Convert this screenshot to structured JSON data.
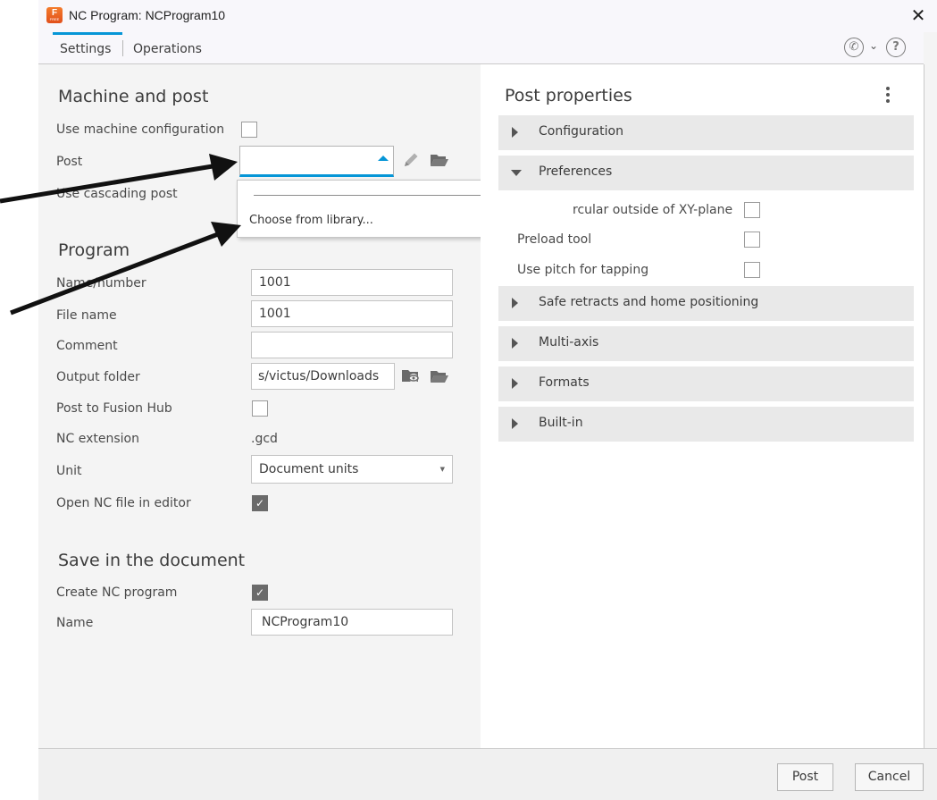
{
  "window": {
    "title": "NC Program: NCProgram10",
    "app_icon_letter": "F",
    "app_icon_sub": "FREE"
  },
  "tabs": {
    "settings": "Settings",
    "operations": "Operations"
  },
  "machine_post": {
    "title": "Machine and post",
    "use_machine_config": "Use machine configuration",
    "post": "Post",
    "use_cascading_post": "Use cascading post",
    "post_value": "",
    "dropdown_item": "Choose from library..."
  },
  "program": {
    "title": "Program",
    "name_number_label": "Name/number",
    "name_number_value": "1001",
    "file_name_label": "File name",
    "file_name_value": "1001",
    "comment_label": "Comment",
    "comment_value": "",
    "output_folder_label": "Output folder",
    "output_folder_value": "s/victus/Downloads",
    "post_to_hub_label": "Post to Fusion Hub",
    "nc_extension_label": "NC extension",
    "nc_extension_value": ".gcd",
    "unit_label": "Unit",
    "unit_value": "Document units",
    "open_in_editor_label": "Open NC file in editor",
    "open_in_editor_checked": true
  },
  "save_doc": {
    "title": "Save in the document",
    "create_nc_label": "Create NC program",
    "create_nc_checked": true,
    "name_label": "Name",
    "name_value": "NCProgram10"
  },
  "post_properties": {
    "title": "Post properties",
    "groups": {
      "configuration": "Configuration",
      "preferences": "Preferences",
      "safe_retracts": "Safe retracts and home positioning",
      "multi_axis": "Multi-axis",
      "formats": "Formats",
      "built_in": "Built-in"
    },
    "preferences": {
      "circular_partial": "rcular outside of XY-plane",
      "preload_tool": "Preload tool",
      "use_pitch": "Use pitch for tapping"
    }
  },
  "footer": {
    "post": "Post",
    "cancel": "Cancel"
  },
  "colors": {
    "accent": "#0696d7",
    "icon_orange": "#e2501c"
  }
}
